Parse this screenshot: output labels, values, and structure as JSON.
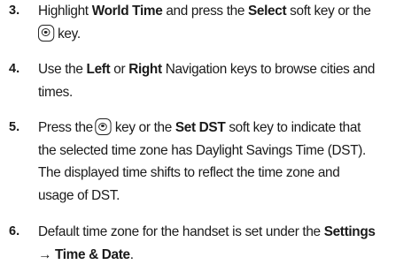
{
  "steps": [
    {
      "number": "3.",
      "lines": [
        [
          "Highlight ",
          "World Time",
          " and press the ",
          "Select",
          " soft key or the"
        ],
        [
          "key."
        ]
      ]
    },
    {
      "number": "4.",
      "lines": [
        [
          "Use the ",
          "Left",
          " or ",
          "Right",
          " Navigation keys to browse cities and"
        ],
        [
          "times."
        ]
      ]
    },
    {
      "number": "5.",
      "lines": [
        [
          "Press the",
          "key or the ",
          "Set DST",
          " soft key to indicate that"
        ],
        [
          "the selected time zone has Daylight Savings Time (DST)."
        ],
        [
          "The displayed time shifts to reflect the time zone and"
        ],
        [
          "usage of DST."
        ]
      ]
    },
    {
      "number": "6.",
      "lines": [
        [
          "Default time zone for the handset is set under the ",
          "Settings"
        ],
        [
          "→ Time & Date",
          "."
        ]
      ]
    }
  ],
  "icons": {
    "select_key": "select-key-icon"
  }
}
